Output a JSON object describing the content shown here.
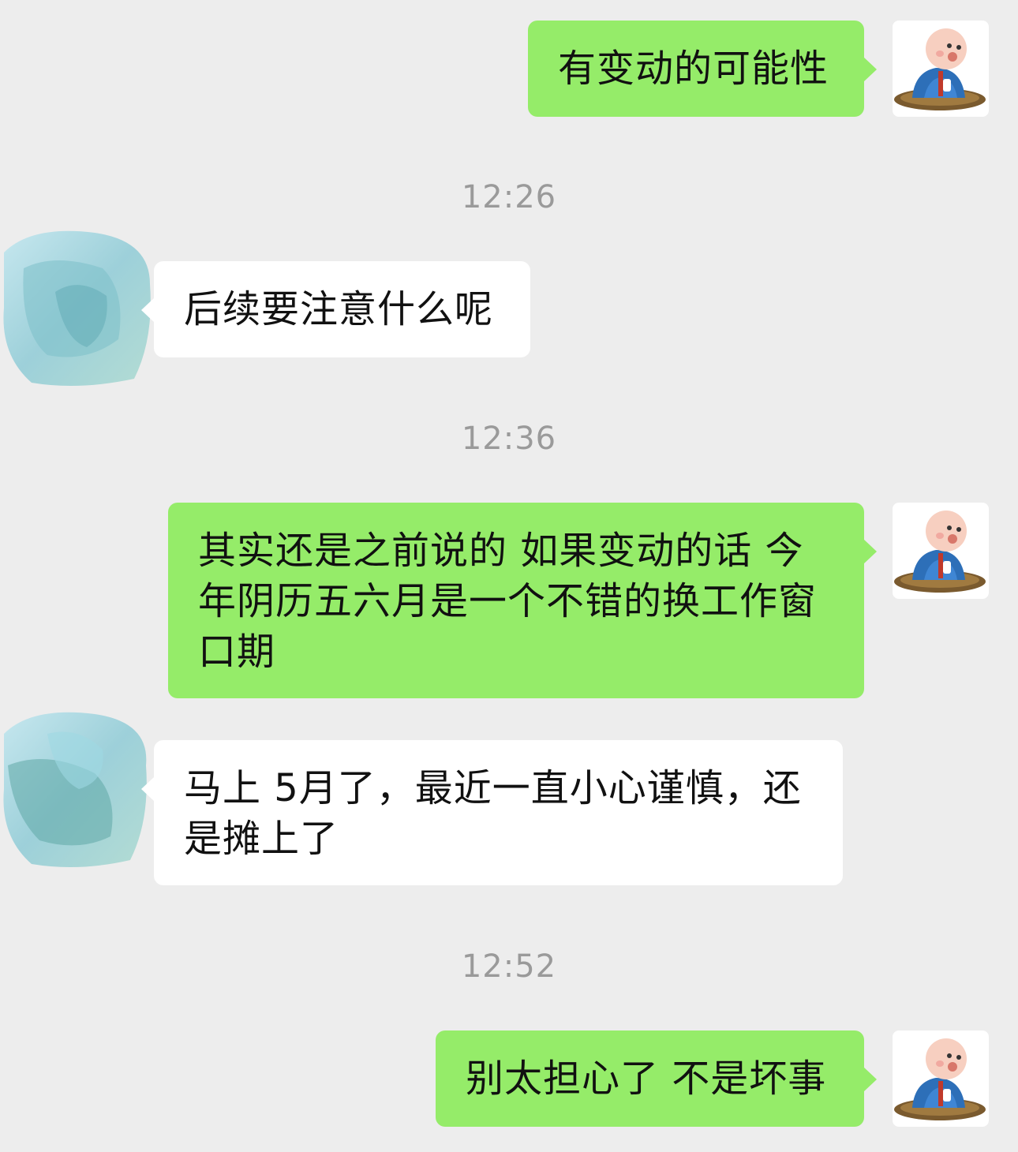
{
  "messages": [
    {
      "type": "message",
      "sender": "me",
      "text": "有变动的可能性"
    },
    {
      "type": "timestamp",
      "text": "12:26"
    },
    {
      "type": "message",
      "sender": "other",
      "text": "后续要注意什么呢"
    },
    {
      "type": "timestamp",
      "text": "12:36"
    },
    {
      "type": "message",
      "sender": "me",
      "text": "其实还是之前说的 如果变动的话 今年阴历五六月是一个不错的换工作窗口期"
    },
    {
      "type": "message",
      "sender": "other",
      "text": "马上 5月了，最近一直小心谨慎，还是摊上了"
    },
    {
      "type": "timestamp",
      "text": "12:52"
    },
    {
      "type": "message",
      "sender": "me",
      "text": "别太担心了 不是坏事"
    }
  ],
  "avatars": {
    "me": "baby-monk-avatar-icon",
    "other": "watercolor-avatar-icon"
  },
  "colors": {
    "background": "#ededed",
    "my_bubble": "#95ec69",
    "other_bubble": "#ffffff",
    "timestamp": "#9a9a9a"
  }
}
